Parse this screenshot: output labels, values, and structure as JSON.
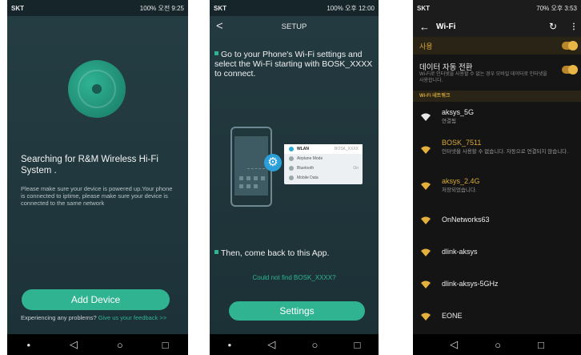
{
  "phone1": {
    "statusbar": {
      "left": "SKT",
      "right": "100% 오전 9:25"
    },
    "title": "Searching for R&M Wireless Hi-Fi System .",
    "description": "Please make sure your device is powered up.Your phone is connected to iptime, please make sure your device is connected to the same network",
    "add_device": "Add Device",
    "experiencing": "Experiencing any problems?",
    "give_feedback": "Give us your feedback >>"
  },
  "phone2": {
    "statusbar": {
      "left": "SKT",
      "right": "100% 오후 12:00"
    },
    "back": "<",
    "title": "SETUP",
    "step1": "Go to your Phone's Wi-Fi settings and select the Wi-Fi starting with BOSK_XXXX to connect.",
    "illustration": {
      "rows": [
        {
          "label": "WLAN",
          "value": "BOSK_XXXX",
          "active": true
        },
        {
          "label": "Airplane Mode",
          "value": ""
        },
        {
          "label": "Bluetooth",
          "value": "On"
        },
        {
          "label": "Mobile Data",
          "value": ""
        }
      ]
    },
    "step2": "Then, come back to this App.",
    "not_found": "Could not find BOSK_XXXX?",
    "settings": "Settings"
  },
  "phone3": {
    "statusbar": {
      "left": "SKT",
      "right": "70% 오후 3:53"
    },
    "back": "←",
    "title": "Wi-Fi",
    "use_label": "사용",
    "auto_switch_title": "데이터 자동 전환",
    "auto_switch_desc": "Wi-Fi로 인터넷을 사용할 수 없는 경우 모바일 데이터로 인터넷을 사용합니다.",
    "networks_header": "Wi-Fi 네트워크",
    "networks": [
      {
        "name": "aksys_5G",
        "status": "연결됨"
      },
      {
        "name": "BOSK_7511",
        "status": "인터넷을 사용할 수 없습니다. 자동으로 연결되지 않습니다."
      },
      {
        "name": "aksys_2.4G",
        "status": "저장되었습니다."
      },
      {
        "name": "OnNetworks63",
        "status": ""
      },
      {
        "name": "dlink-aksys",
        "status": ""
      },
      {
        "name": "dlink-aksys-5GHz",
        "status": ""
      },
      {
        "name": "EONE",
        "status": ""
      }
    ]
  },
  "navbar": {
    "dot": "•",
    "back": "◁",
    "home": "○",
    "recent": "□"
  }
}
